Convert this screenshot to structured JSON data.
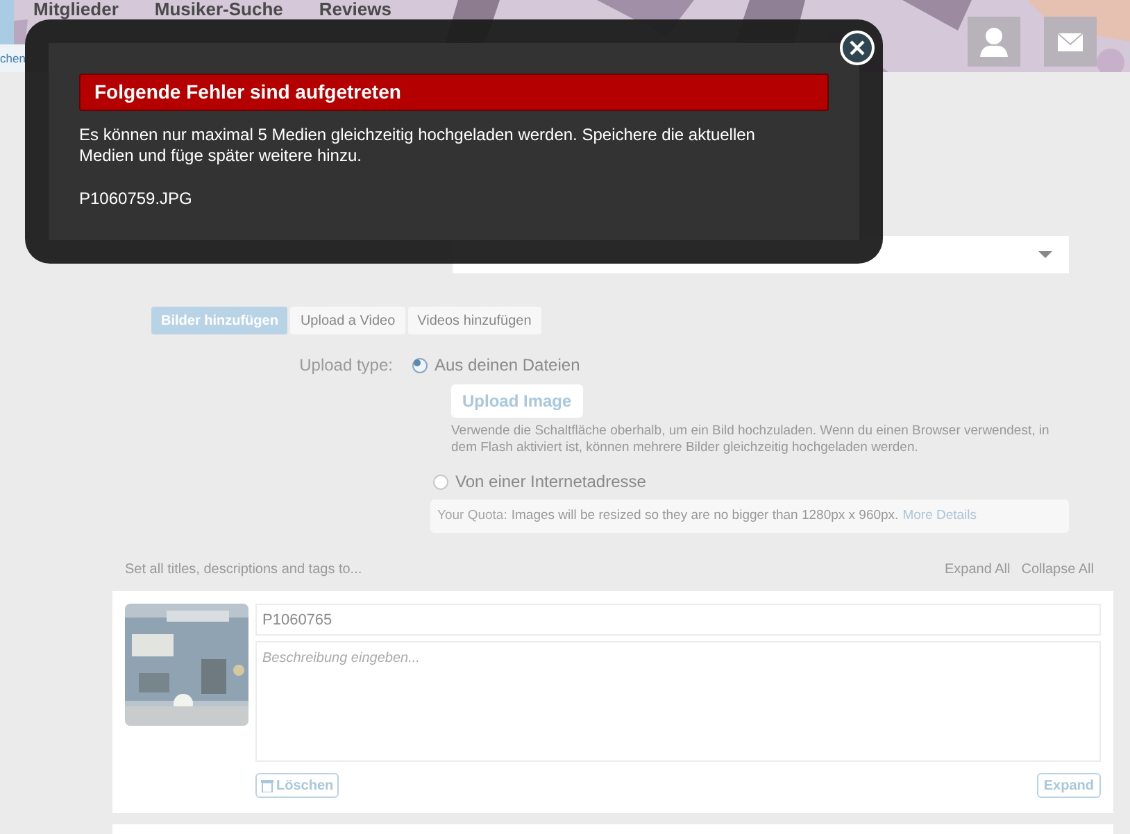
{
  "header": {
    "nav": [
      {
        "label": "Mitglieder"
      },
      {
        "label": "Musiker-Suche"
      },
      {
        "label": "Reviews"
      }
    ],
    "subnav": [
      {
        "label": "chen"
      }
    ]
  },
  "form": {
    "tabs": [
      {
        "label": "Bilder hinzufügen",
        "selected": true
      },
      {
        "label": "Upload a Video",
        "selected": false
      },
      {
        "label": "Videos hinzufügen",
        "selected": false
      }
    ],
    "upload_type_label": "Upload type:",
    "options": [
      {
        "label": "Aus deinen Dateien",
        "selected": true
      },
      {
        "label": "Von einer Internetadresse",
        "selected": false
      }
    ],
    "upload_button": "Upload Image",
    "help": "Verwende die Schaltfläche oberhalb, um ein Bild hochzuladen. Wenn du einen Browser verwendest, in dem Flash aktiviert ist, können mehrere Bilder gleichzeitig hochgeladen werden.",
    "quota": {
      "label": "Your Quota:",
      "text": "Images will be resized so they are no bigger than 1280px x 960px.",
      "link": "More Details"
    },
    "batch_label": "Set all titles, descriptions and tags to...",
    "expand_all": "Expand All",
    "collapse_all": "Collapse All",
    "items": [
      {
        "kind": "picture",
        "title": "P1060765",
        "description_placeholder": "Beschreibung eingeben...",
        "delete_button": "Löschen",
        "expand_button": "Expand"
      }
    ]
  },
  "modal": {
    "title": "Folgende Fehler sind aufgetreten",
    "message": "Es können nur maximal 5 Medien gleichzeitig hochgeladen werden. Speichere die aktuellen Medien und füge später weitere hinzu.",
    "files": [
      "P1060759.JPG"
    ]
  }
}
